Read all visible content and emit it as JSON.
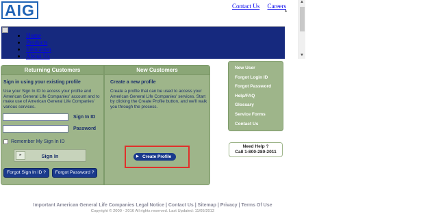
{
  "header": {
    "logo_text": "AIG",
    "top_links": [
      "Contact Us",
      "Careers"
    ],
    "nav_items": [
      "Home",
      "Products",
      "Education",
      "About Us"
    ]
  },
  "returning": {
    "title": "Returning Customers",
    "subtitle": "Sign in using your existing profile",
    "description": "Use your Sign In ID to access your profile and American General Life Companies' account and to make use of American General Life Companies' various services.",
    "signin_id_label": "Sign In ID",
    "password_label": "Password",
    "signin_id_value": "",
    "password_value": "",
    "remember_label": "Remember My Sign In ID",
    "signin_button": "Sign In",
    "forgot_id_button": "Forgot Sign In ID ?",
    "forgot_pw_button": "Forgot Password ?"
  },
  "new_customers": {
    "title": "New Customers",
    "subtitle": "Create a new profile",
    "description": "Create a profile that can be used to access your American General Life Companies' services. Start by clicking the Create Profile button, and we'll walk you through the process.",
    "create_button": "Create Profile"
  },
  "side_links": [
    "New User",
    "Forgot Login ID",
    "Forgot Password",
    "Help/FAQ",
    "Glossary",
    "Service Forms",
    "Contact Us"
  ],
  "help": {
    "line1": "Need Help ?",
    "line2": "Call 1-800-280-2011"
  },
  "footer": {
    "links": "Important American General Life Companies Legal Notice | Contact Us | Sitemap | Privacy | Terms Of Use",
    "copyright": "Copyright © 2000 - 2016 All rights reserved. Last Updated: 11/05/2012"
  },
  "colors": {
    "panel_green": "#9eb58a",
    "nav_blue": "#16297e",
    "button_blue": "#1a3a8c",
    "highlight_red": "#e0302a"
  }
}
